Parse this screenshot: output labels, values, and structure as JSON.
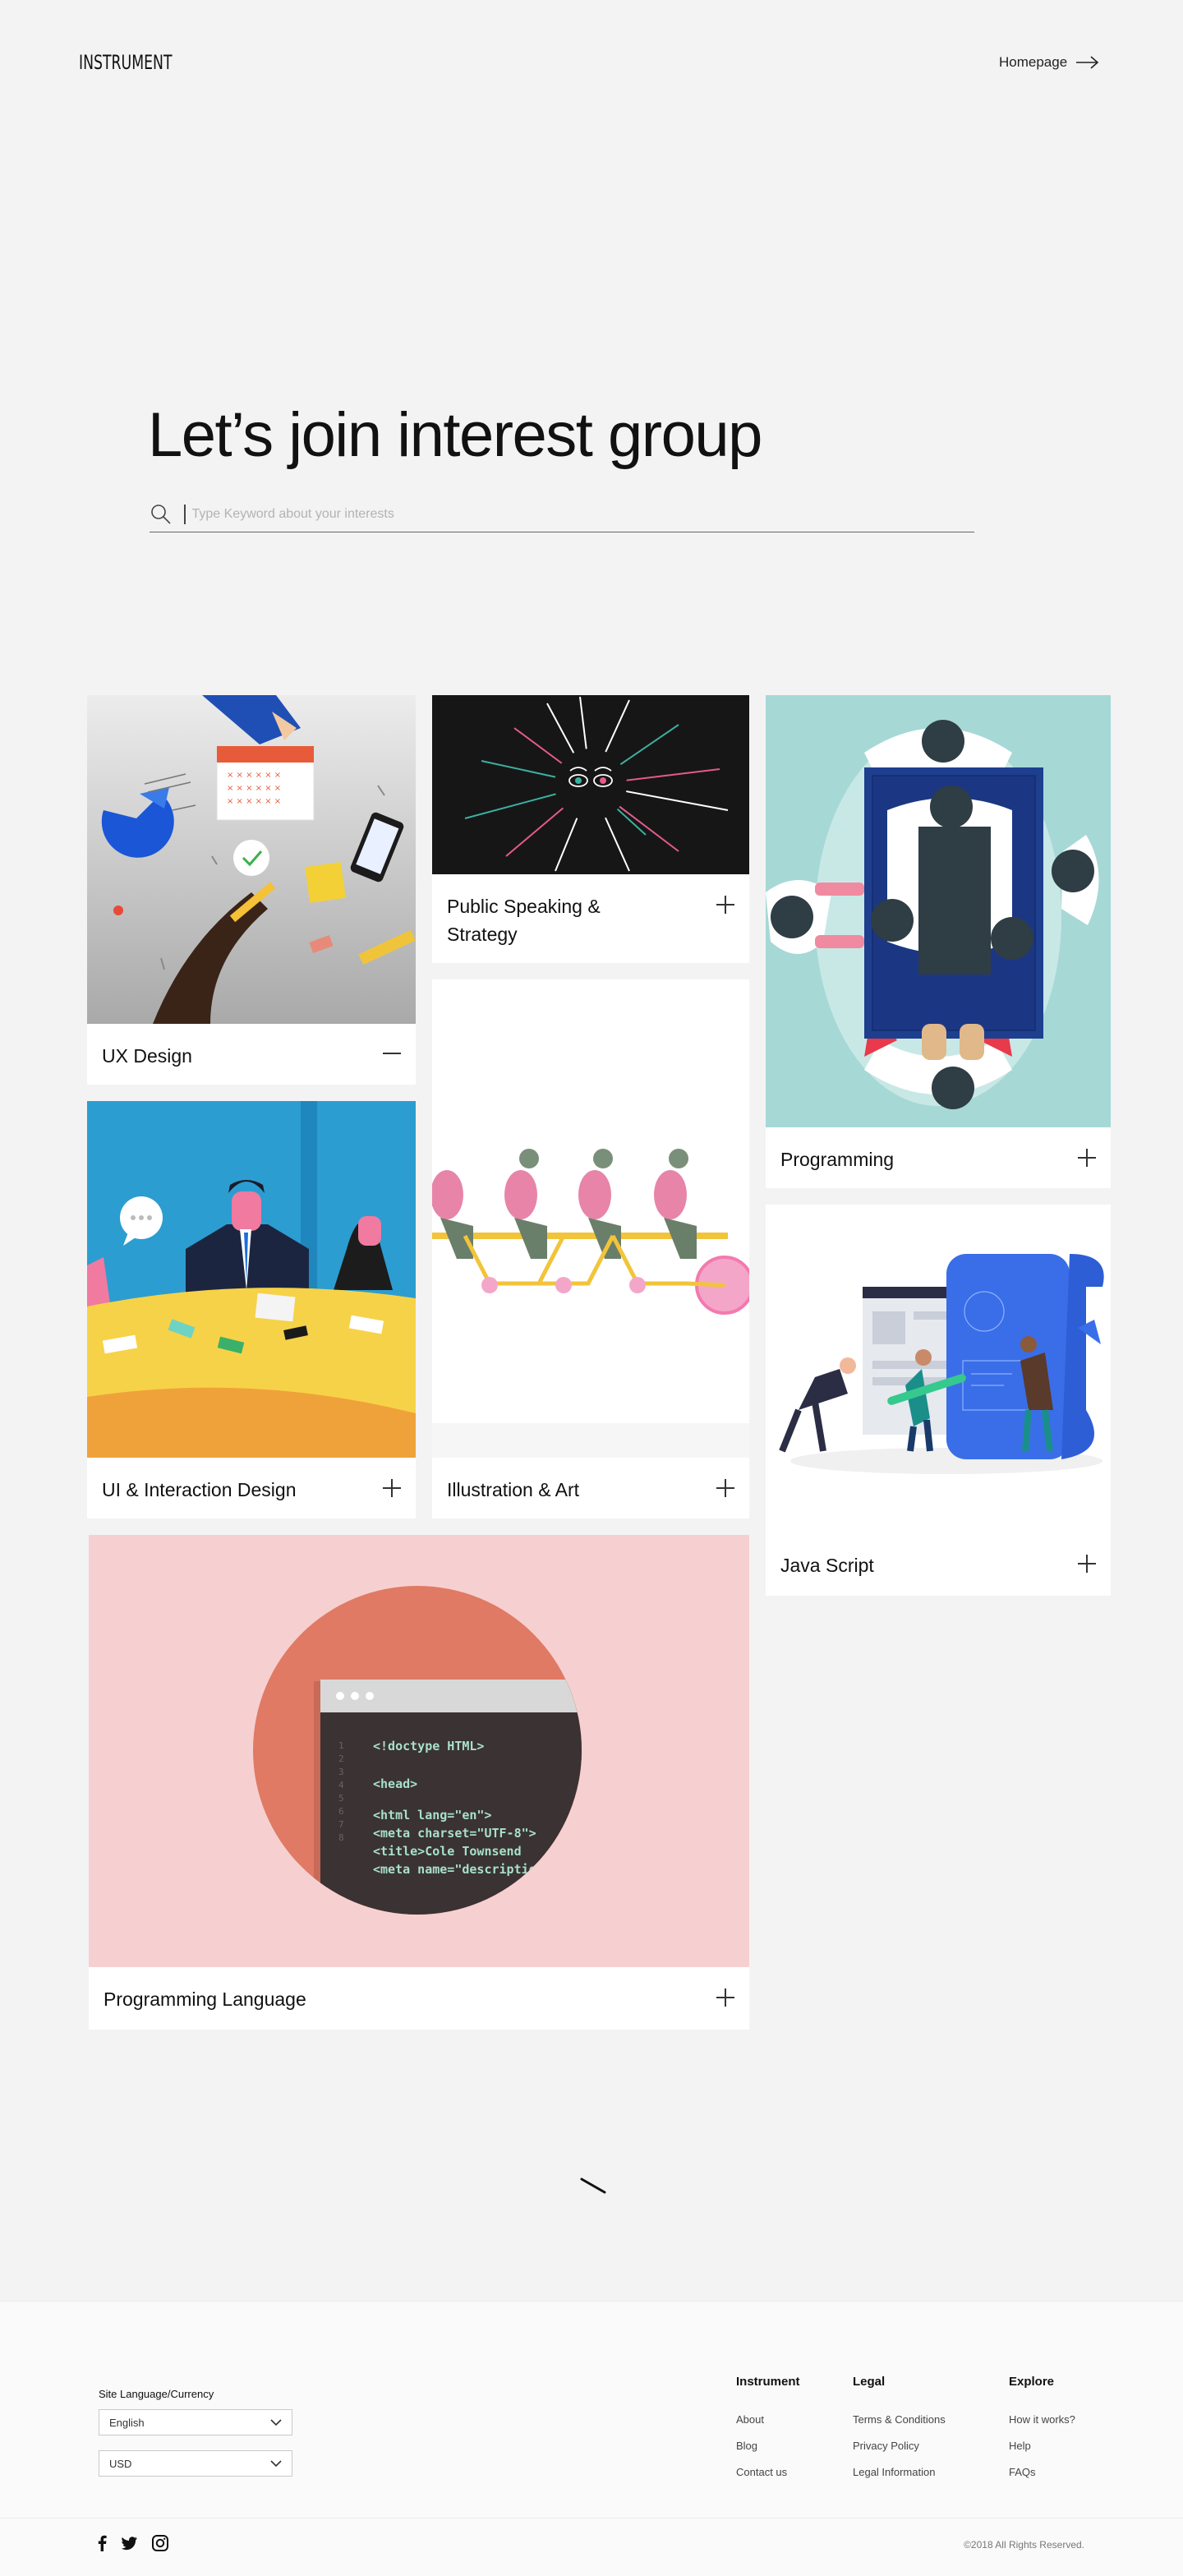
{
  "header": {
    "logo": "INSTRUMENT",
    "homepage_link": "Homepage"
  },
  "hero": {
    "title": "Let’s join interest group",
    "search_placeholder": "Type Keyword about your interests"
  },
  "cards": [
    {
      "label": "UX Design",
      "state": "expanded"
    },
    {
      "label": "Public Speaking & Strategy",
      "state": "collapsed"
    },
    {
      "label": "Programming",
      "state": "collapsed"
    },
    {
      "label": "UI & Interaction Design",
      "state": "collapsed"
    },
    {
      "label": "Illustration & Art",
      "state": "collapsed"
    },
    {
      "label": "Java Script",
      "state": "collapsed"
    },
    {
      "label": "Programming Language",
      "state": "collapsed"
    }
  ],
  "code_snippet": {
    "line_numbers": [
      "1",
      "2",
      "3",
      "4",
      "5",
      "6",
      "7",
      "8"
    ],
    "lines": [
      "<!doctype HTML>",
      "",
      "<head>",
      "",
      "<html lang=\"en\">",
      "<meta charset=\"UTF-8\">",
      "<title>Cole Townsend",
      "<meta name=\"description"
    ]
  },
  "footer": {
    "site_language_label": "Site Language/Currency",
    "language_select": "English",
    "currency_select": "USD",
    "columns": [
      {
        "title": "Instrument",
        "links": [
          "About",
          "Blog",
          "Contact us"
        ]
      },
      {
        "title": "Legal",
        "links": [
          "Terms & Conditions",
          "Privacy Policy",
          "Legal Information"
        ]
      },
      {
        "title": "Explore",
        "links": [
          "How it works?",
          "Help",
          "FAQs"
        ]
      }
    ],
    "copyright": "©2018 All Rights Reserved.",
    "social_icons": [
      "facebook-icon",
      "twitter-icon",
      "instagram-icon"
    ]
  },
  "colors": {
    "page_bg": "#f3f3f3",
    "card_bg": "#ffffff",
    "ux_bg": "#d9d9d9",
    "speaking_bg": "#161616",
    "programming_bg": "#a6d8d6",
    "ui_bg": "#2b9dd1",
    "java_accent": "#3a6ee8",
    "language_bg": "#f6d0d0",
    "language_circle": "#e07a64"
  }
}
